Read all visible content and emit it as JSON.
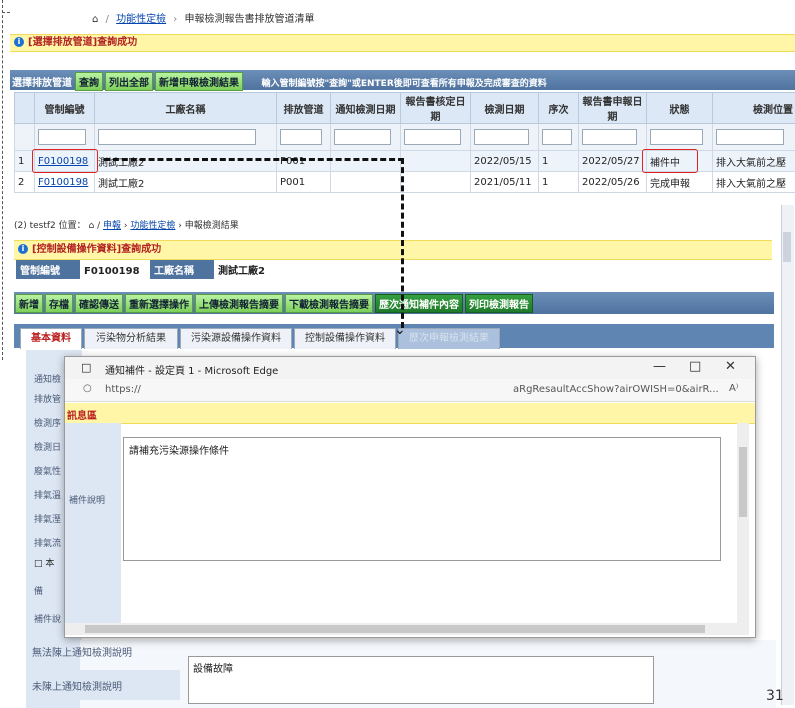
{
  "breadcrumb_top": {
    "prefix_icon": "home-icon",
    "link1": "功能性定檢",
    "current": "申報檢測報告書排放管道清單"
  },
  "msg_top": "[選擇排放管道]查詢成功",
  "toolbar1": {
    "label_select": "選擇排放管道",
    "btn_query": "查詢",
    "btn_list_all": "列出全部",
    "btn_add_report": "新增申報檢測結果",
    "hint": "輸入管制編號按\"查詢\"或ENTER後即可查看所有申報及完成審查的資料"
  },
  "table": {
    "headers": [
      "管制編號",
      "工廠名稱",
      "排放管道",
      "通知檢測日期",
      "報告書核定日期",
      "檢測日期",
      "序次",
      "報告書申報日期",
      "狀態",
      "檢測位置"
    ],
    "rows": [
      {
        "no": "1",
        "id": "F0100198",
        "factory": "測試工廠2",
        "pipe": "P001",
        "notify": "",
        "approve": "",
        "date": "2022/05/15",
        "seq": "1",
        "report": "2022/05/27",
        "status": "補件中",
        "location": "排入大氣前之壓"
      },
      {
        "no": "2",
        "id": "F0100198",
        "factory": "測試工廠2",
        "pipe": "P001",
        "notify": "",
        "approve": "",
        "date": "2021/05/11",
        "seq": "1",
        "report": "2022/05/26",
        "status": "完成申報",
        "location": "排入大氣前之壓"
      }
    ]
  },
  "breadcrumb2": {
    "prefix": "(2) testf2 位置：",
    "home_icon": "home-icon",
    "link1": "申報",
    "link2": "功能性定檢",
    "current": "申報檢測結果"
  },
  "msg2": "[控制設備操作資料]查詢成功",
  "bar2": {
    "label_id": "管制編號",
    "value_id": "F0100198",
    "label_factory": "工廠名稱",
    "value_factory": "測試工廠2"
  },
  "toolbar2": {
    "btn_add": "新增",
    "btn_save": "存檔",
    "btn_confirm": "確認傳送",
    "btn_reselect": "重新選擇操作",
    "btn_upload": "上傳檢測報告摘要",
    "btn_download": "下載檢測報告摘要",
    "btn_history": "歷次通知補件內容",
    "btn_print": "列印檢測報告"
  },
  "tabs": [
    "基本資料",
    "污染物分析結果",
    "污染源設備操作資料",
    "控制設備操作資料",
    "歷次申報檢測結果"
  ],
  "left_labels": [
    "通知檢",
    "排放管",
    "檢測序",
    "檢測日",
    "廢氣性",
    "排氣溫",
    "排氣溼",
    "排氣流",
    "□ 本",
    "備",
    "補件說"
  ],
  "below": {
    "label1": "無法陳上通知檢測說明",
    "label2": "未陳上通知檢測說明",
    "textarea": "設備故障"
  },
  "popup": {
    "title": "通知補件 - 設定頁 1 - Microsoft Edge",
    "url": "https://",
    "url_tail": "aRgResaultAccShow?airOWISH=0&airR...",
    "msg": "訊息區",
    "label": "補件說明",
    "text": "請補充污染源操作條件"
  },
  "page_number": "31"
}
